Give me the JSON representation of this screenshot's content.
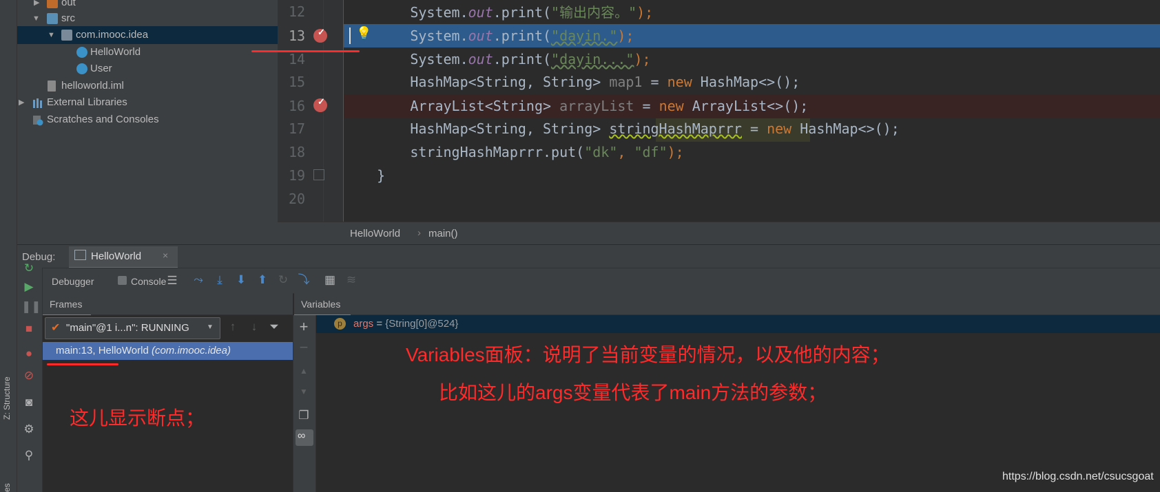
{
  "project_tree": {
    "items": [
      {
        "label": "out",
        "kind": "folder-out"
      },
      {
        "label": "src",
        "kind": "folder-src"
      },
      {
        "label": "com.imooc.idea",
        "kind": "package"
      },
      {
        "label": "HelloWorld",
        "kind": "class"
      },
      {
        "label": "User",
        "kind": "class"
      },
      {
        "label": "helloworld.iml",
        "kind": "module-file"
      },
      {
        "label": "External Libraries",
        "kind": "libraries"
      },
      {
        "label": "Scratches and Consoles",
        "kind": "scratches"
      }
    ]
  },
  "side_strip": {
    "structure_label": "Z: Structure",
    "favorites_label": "es"
  },
  "editor": {
    "line_numbers": [
      "12",
      "13",
      "14",
      "15",
      "16",
      "17",
      "18",
      "19",
      "20"
    ],
    "code": {
      "l12_a": "        System.",
      "l12_b": "out",
      "l12_c": ".print(",
      "l12_d": "\"输出内容。\"",
      "l12_e": ");",
      "l13_a": "        System.",
      "l13_b": "out",
      "l13_c": ".print(",
      "l13_d": "\"dayin.\"",
      "l13_e": ");",
      "l14_a": "        System.",
      "l14_b": "out",
      "l14_c": ".print(",
      "l14_d": "\"dayin...\"",
      "l14_e": ");",
      "l15_a": "        HashMap<String, String> ",
      "l15_b": "map1",
      "l15_c": " = ",
      "l15_d": "new",
      "l15_e": " HashMap<>();",
      "l16_a": "        ArrayList<String> ",
      "l16_b": "arrayList",
      "l16_c": " = ",
      "l16_d": "new",
      "l16_e": " ArrayList<>();",
      "l17_a": "        HashMap<String, String> ",
      "l17_b": "stringHashMaprrr",
      "l17_c": " = ",
      "l17_d": "new",
      "l17_e": " HashMap<>();",
      "l18_a": "        stringHashMaprrr.put(",
      "l18_b": "\"dk\"",
      "l18_c": ", ",
      "l18_d": "\"df\"",
      "l18_e": ");",
      "l19": "    }"
    },
    "breadcrumb": {
      "class": "HelloWorld",
      "separator": "›",
      "method": "main()"
    }
  },
  "debug": {
    "label": "Debug:",
    "config_tab": "HelloWorld",
    "tabs": {
      "debugger": "Debugger",
      "console": "Console"
    },
    "frames_header": "Frames",
    "variables_header": "Variables",
    "thread_select": "\"main\"@1 i...n\": RUNNING",
    "frame_item": {
      "main": "main:13, HelloWorld ",
      "pkg": "(com.imooc.idea)"
    },
    "variable": {
      "badge": "p",
      "name": "args",
      "eq": " = ",
      "value": "{String[0]@524}"
    }
  },
  "annotations": {
    "variables_note_1": "Variables面板：说明了当前变量的情况，以及他的内容；",
    "variables_note_2": "比如这儿的args变量代表了main方法的参数；",
    "frames_note": "这儿显示断点；"
  },
  "watermark": "https://blog.csdn.net/csucsgoat",
  "colors": {
    "selected_line": "#2d5b8c",
    "breakpoint_line": "#3a2323",
    "breakpoint": "#c75450",
    "annotation": "#ff2a2a",
    "frame_selected": "#4b6eaf"
  }
}
